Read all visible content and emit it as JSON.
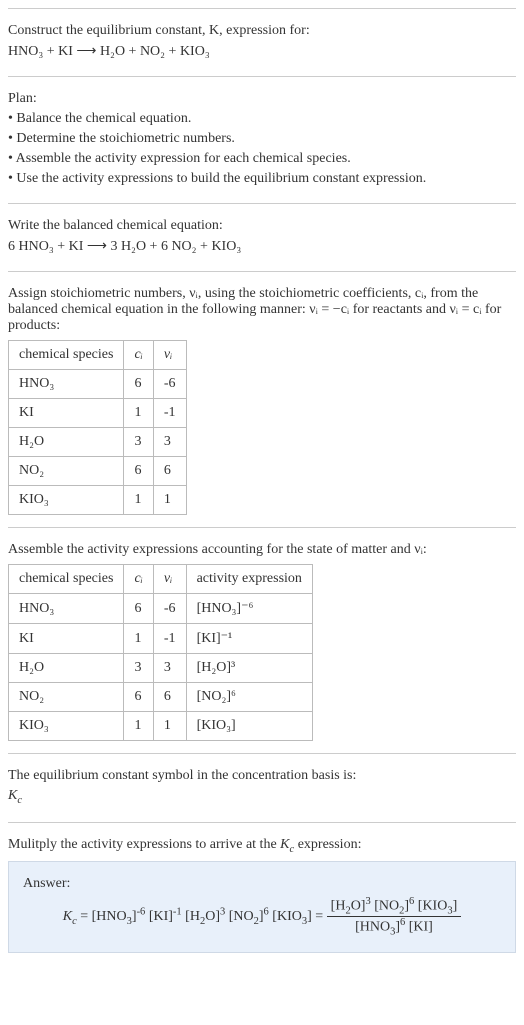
{
  "intro": {
    "line1": "Construct the equilibrium constant, K, expression for:",
    "equation": "HNO₃ + KI ⟶ H₂O + NO₂ + KIO₃"
  },
  "plan": {
    "title": "Plan:",
    "b1": "• Balance the chemical equation.",
    "b2": "• Determine the stoichiometric numbers.",
    "b3": "• Assemble the activity expression for each chemical species.",
    "b4": "• Use the activity expressions to build the equilibrium constant expression."
  },
  "balanced": {
    "title": "Write the balanced chemical equation:",
    "equation": "6 HNO₃ + KI ⟶ 3 H₂O + 6 NO₂ + KIO₃"
  },
  "stoich": {
    "intro1": "Assign stoichiometric numbers, νᵢ, using the stoichiometric coefficients, cᵢ, from the balanced chemical equation in the following manner: νᵢ = −cᵢ for reactants and νᵢ = cᵢ for products:",
    "headers": {
      "h1": "chemical species",
      "h2": "cᵢ",
      "h3": "νᵢ"
    },
    "rows": [
      {
        "sp": "HNO₃",
        "c": "6",
        "v": "-6"
      },
      {
        "sp": "KI",
        "c": "1",
        "v": "-1"
      },
      {
        "sp": "H₂O",
        "c": "3",
        "v": "3"
      },
      {
        "sp": "NO₂",
        "c": "6",
        "v": "6"
      },
      {
        "sp": "KIO₃",
        "c": "1",
        "v": "1"
      }
    ]
  },
  "activity": {
    "intro": "Assemble the activity expressions accounting for the state of matter and νᵢ:",
    "headers": {
      "h1": "chemical species",
      "h2": "cᵢ",
      "h3": "νᵢ",
      "h4": "activity expression"
    },
    "rows": [
      {
        "sp": "HNO₃",
        "c": "6",
        "v": "-6",
        "a": "[HNO₃]⁻⁶"
      },
      {
        "sp": "KI",
        "c": "1",
        "v": "-1",
        "a": "[KI]⁻¹"
      },
      {
        "sp": "H₂O",
        "c": "3",
        "v": "3",
        "a": "[H₂O]³"
      },
      {
        "sp": "NO₂",
        "c": "6",
        "v": "6",
        "a": "[NO₂]⁶"
      },
      {
        "sp": "KIO₃",
        "c": "1",
        "v": "1",
        "a": "[KIO₃]"
      }
    ]
  },
  "kc_symbol": {
    "line1": "The equilibrium constant symbol in the concentration basis is:",
    "line2": "K_c"
  },
  "multiply": {
    "line": "Mulitply the activity expressions to arrive at the K_c expression:"
  },
  "answer": {
    "label": "Answer:",
    "lhs": "K_c = [HNO₃]⁻⁶ [KI]⁻¹ [H₂O]³ [NO₂]⁶ [KIO₃] = ",
    "num": "[H₂O]³ [NO₂]⁶ [KIO₃]",
    "den": "[HNO₃]⁶ [KI]"
  },
  "chart_data": {
    "type": "table",
    "tables": [
      {
        "title": "Stoichiometric numbers",
        "columns": [
          "chemical species",
          "c_i",
          "ν_i"
        ],
        "rows": [
          [
            "HNO3",
            6,
            -6
          ],
          [
            "KI",
            1,
            -1
          ],
          [
            "H2O",
            3,
            3
          ],
          [
            "NO2",
            6,
            6
          ],
          [
            "KIO3",
            1,
            1
          ]
        ]
      },
      {
        "title": "Activity expressions",
        "columns": [
          "chemical species",
          "c_i",
          "ν_i",
          "activity expression"
        ],
        "rows": [
          [
            "HNO3",
            6,
            -6,
            "[HNO3]^-6"
          ],
          [
            "KI",
            1,
            -1,
            "[KI]^-1"
          ],
          [
            "H2O",
            3,
            3,
            "[H2O]^3"
          ],
          [
            "NO2",
            6,
            6,
            "[NO2]^6"
          ],
          [
            "KIO3",
            1,
            1,
            "[KIO3]"
          ]
        ]
      }
    ]
  }
}
